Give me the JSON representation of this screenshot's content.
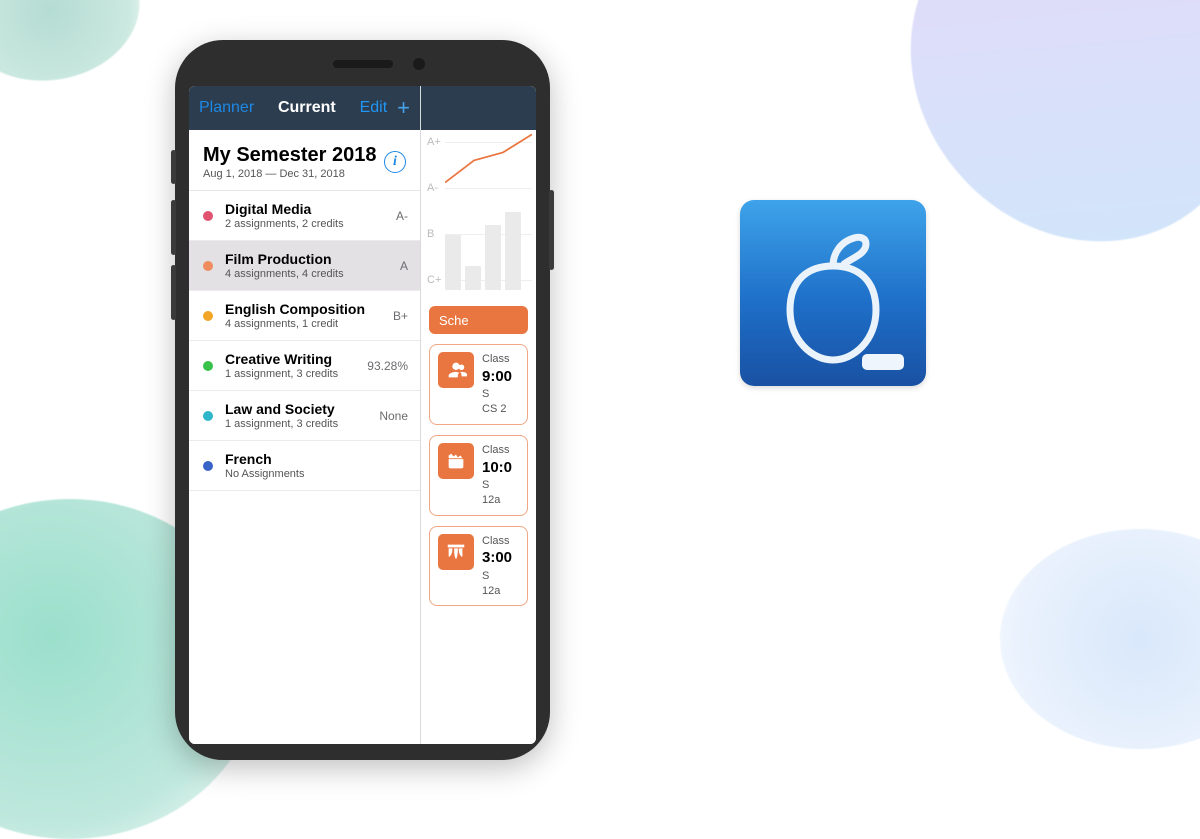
{
  "nav": {
    "back": "Planner",
    "title": "Current",
    "edit": "Edit"
  },
  "semester": {
    "title": "My Semester 2018",
    "dates": "Aug 1, 2018 — Dec 31, 2018"
  },
  "courses": [
    {
      "color": "#e0526e",
      "title": "Digital Media",
      "sub": "2 assignments, 2 credits",
      "grade": "A-"
    },
    {
      "color": "#ee8c5d",
      "title": "Film Production",
      "sub": "4 assignments, 4 credits",
      "grade": "A",
      "selected": true
    },
    {
      "color": "#f1a626",
      "title": "English Composition",
      "sub": "4 assignments, 1 credit",
      "grade": "B+"
    },
    {
      "color": "#38c24a",
      "title": "Creative Writing",
      "sub": "1 assignment, 3 credits",
      "grade": "93.28%"
    },
    {
      "color": "#2eb7c9",
      "title": "Law and Society",
      "sub": "1 assignment, 3 credits",
      "grade": "None"
    },
    {
      "color": "#3a63c8",
      "title": "French",
      "sub": "No Assignments",
      "grade": ""
    }
  ],
  "chart_data": {
    "type": "bar",
    "yticks": [
      "A+",
      "A-",
      "B",
      "C+"
    ],
    "bars": [
      55,
      24,
      65,
      78
    ],
    "line": [
      30,
      52,
      60,
      78
    ]
  },
  "schedule_button": "Sche",
  "events": [
    {
      "icon": "people",
      "label": "Class",
      "time": "9:00",
      "l1": "S",
      "l2": "CS 2"
    },
    {
      "icon": "clapper",
      "label": "Class",
      "time": "10:0",
      "l1": "S",
      "l2": "12a"
    },
    {
      "icon": "curtain",
      "label": "Class",
      "time": "3:00",
      "l1": "S",
      "l2": "12a"
    }
  ]
}
